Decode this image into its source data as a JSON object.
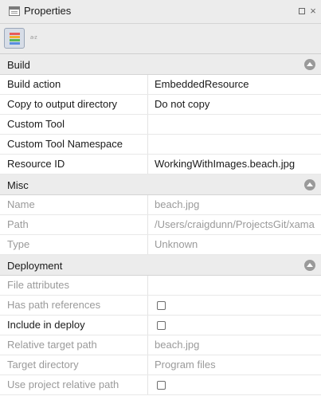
{
  "window": {
    "title": "Properties",
    "icons": {
      "panel": "properties-panel-icon",
      "restore": "restore-icon",
      "close": "close-icon"
    },
    "close_glyph": "×"
  },
  "toolbar": {
    "categorized_icon": "categorized-view-icon",
    "sorted_icon": "alphabetical-sort-icon",
    "sort_glyph": "a-z"
  },
  "sections": {
    "build": {
      "label": "Build",
      "rows": [
        {
          "name": "Build action",
          "value": "EmbeddedResource"
        },
        {
          "name": "Copy to output directory",
          "value": "Do not copy"
        },
        {
          "name": "Custom Tool",
          "value": ""
        },
        {
          "name": "Custom Tool Namespace",
          "value": ""
        },
        {
          "name": "Resource ID",
          "value": "WorkingWithImages.beach.jpg"
        }
      ]
    },
    "misc": {
      "label": "Misc",
      "rows": [
        {
          "name": "Name",
          "value": "beach.jpg"
        },
        {
          "name": "Path",
          "value": "/Users/craigdunn/ProjectsGit/xama"
        },
        {
          "name": "Type",
          "value": "Unknown"
        }
      ]
    },
    "deployment": {
      "label": "Deployment",
      "rows": [
        {
          "name": "File attributes",
          "value": ""
        },
        {
          "name": "Has path references",
          "checked": false
        },
        {
          "name": "Include in deploy",
          "checked": false
        },
        {
          "name": "Relative target path",
          "value": "beach.jpg"
        },
        {
          "name": "Target directory",
          "value": "Program files"
        },
        {
          "name": "Use project relative path",
          "checked": false
        }
      ]
    }
  },
  "colors": {
    "header_bg": "#ececec",
    "disabled_text": "#9a9a9a",
    "active_button": "#d7dde7"
  }
}
